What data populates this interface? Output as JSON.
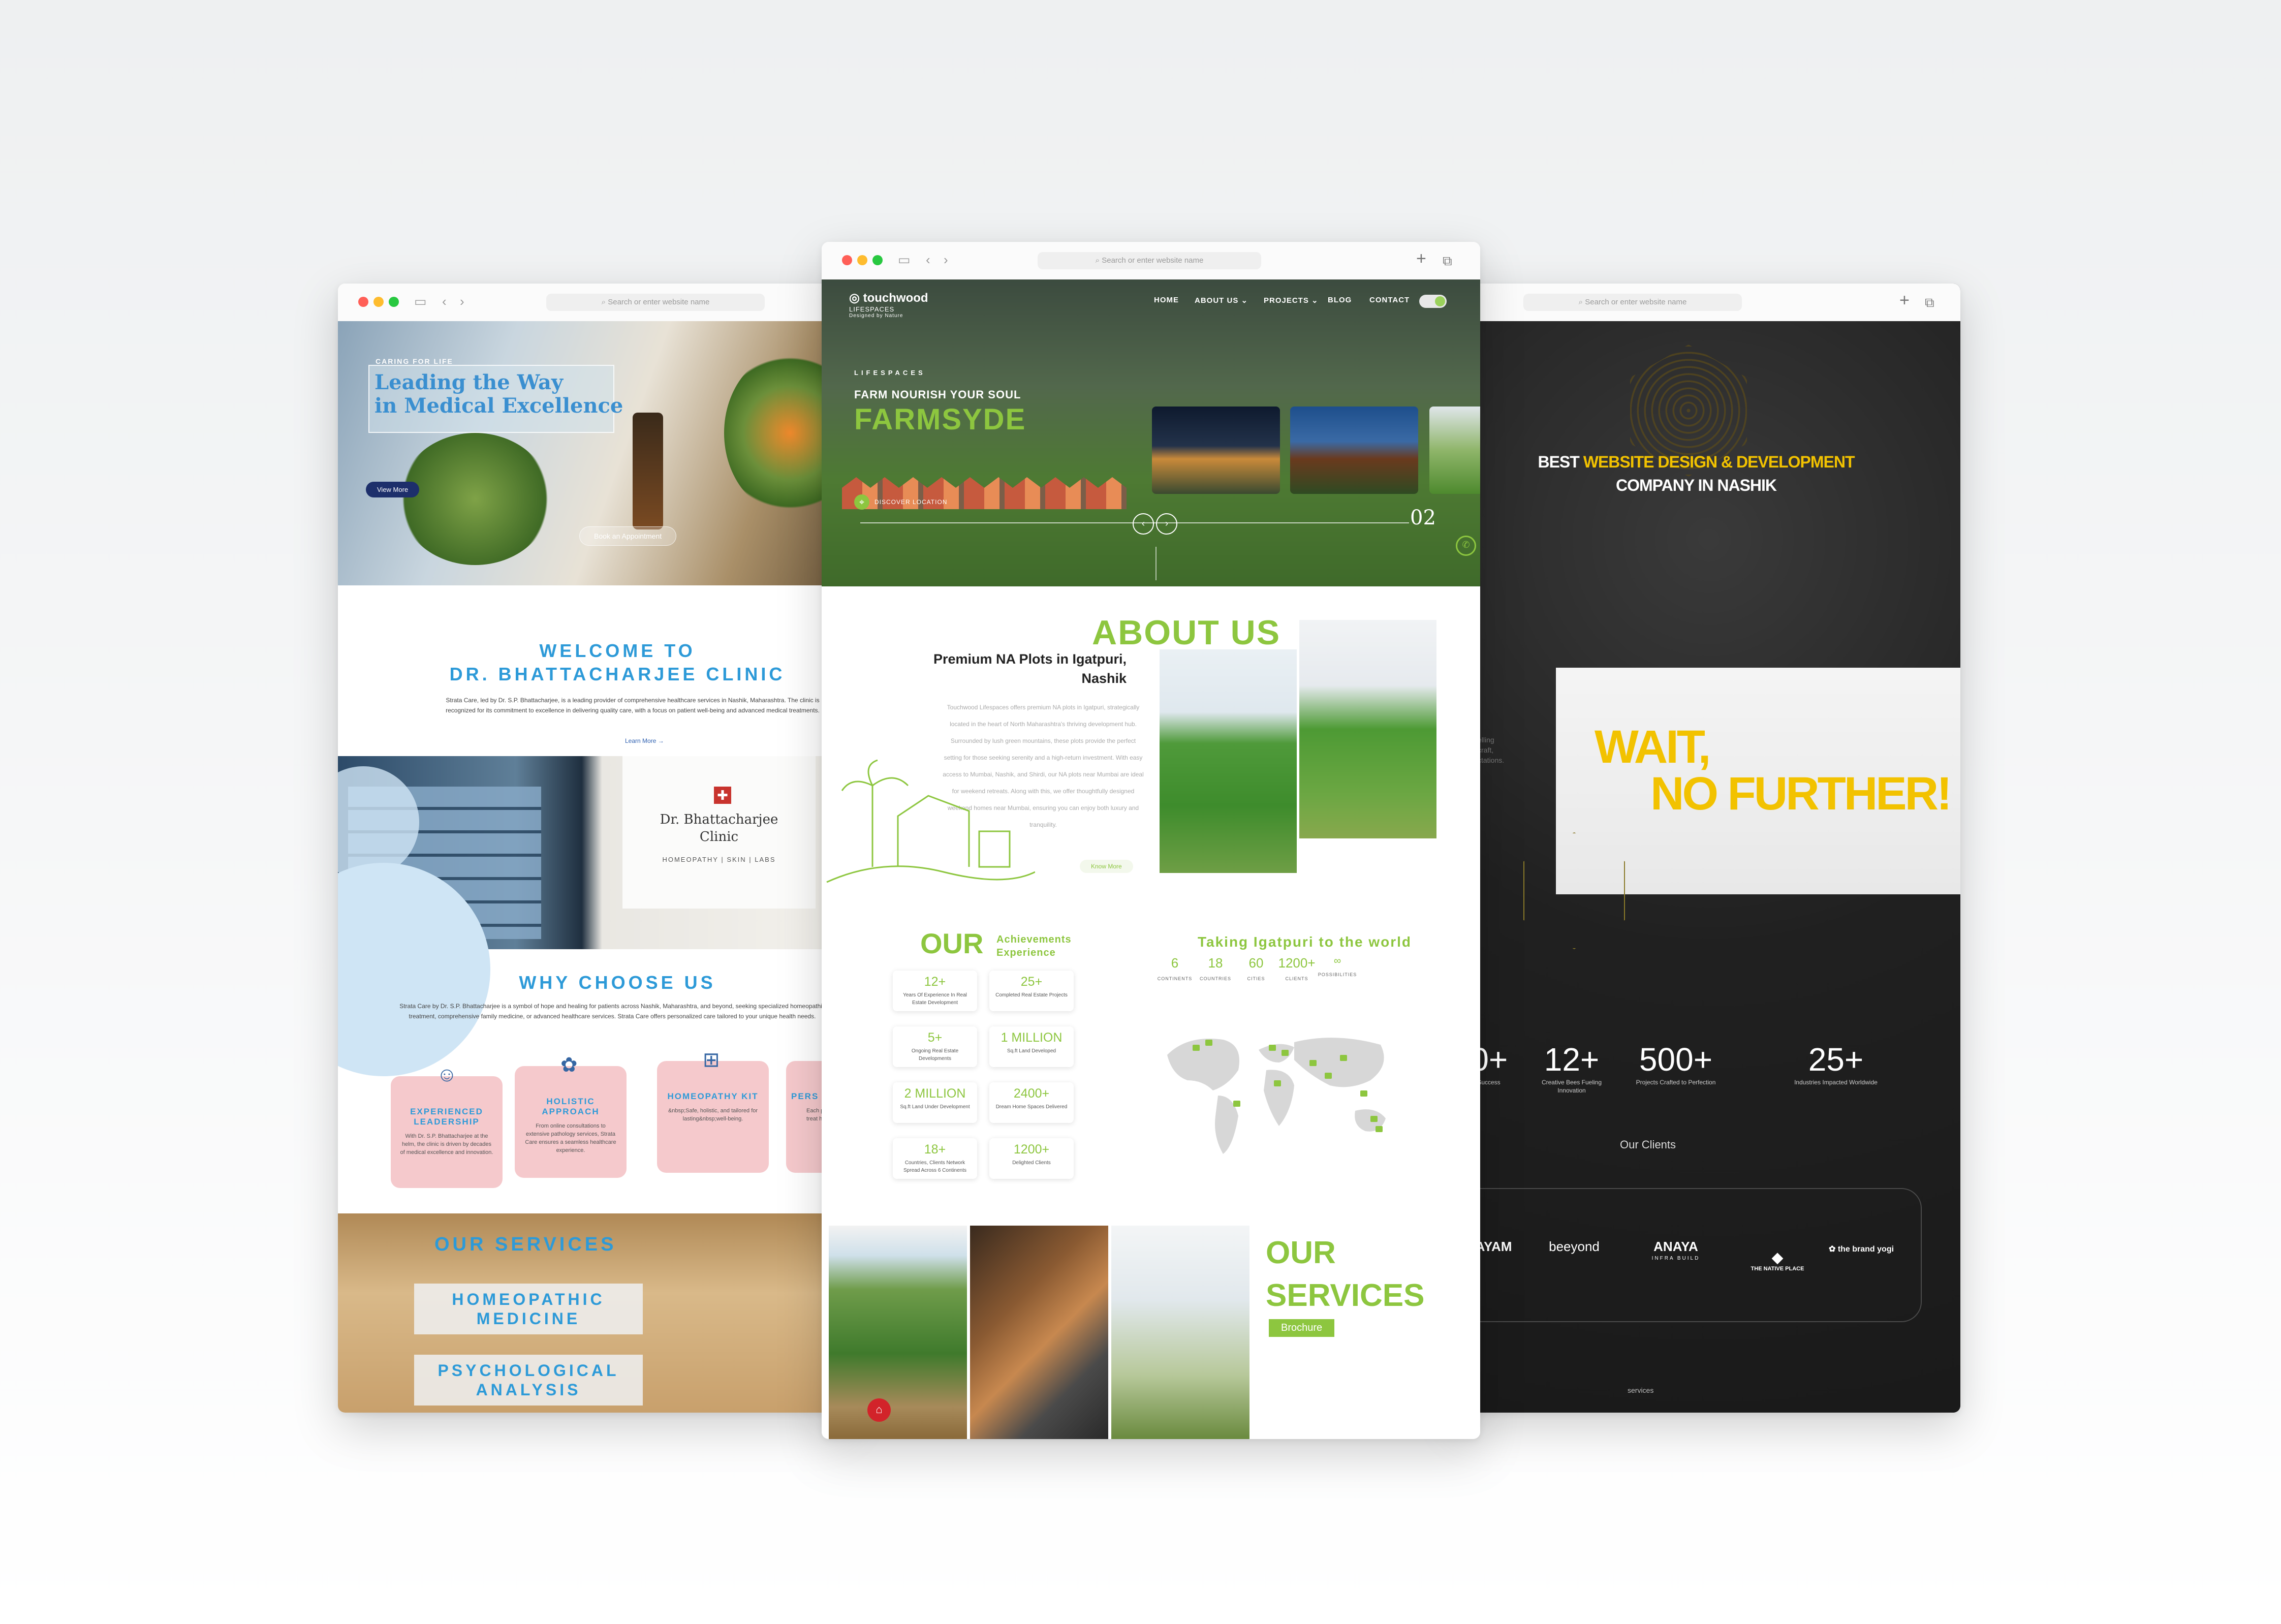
{
  "browser": {
    "url_placeholder": "Search or enter website name",
    "plus_icon": "+",
    "tabs_icon": "⧉"
  },
  "left_site": {
    "hero": {
      "kicker": "CARING FOR LIFE",
      "title_line1": "Leading the Way",
      "title_line2": "in Medical Excellence",
      "view_more": "View More",
      "book": "Book an Appointment"
    },
    "welcome": {
      "line1": "WELCOME TO",
      "line2": "DR. BHATTACHARJEE CLINIC",
      "paragraph": "Strata Care, led by Dr. S.P. Bhattacharjee, is a leading provider of comprehensive healthcare services in Nashik, Maharashtra. The clinic is recognized for its commitment to excellence in delivering quality care, with a focus on patient well-being and advanced medical treatments.",
      "learn_more": "Learn More →"
    },
    "clinic_sign": {
      "name_line1": "Dr. Bhattacharjee",
      "name_line2": "Clinic",
      "tagline": "HOMEOPATHY | SKIN | LABS"
    },
    "why": {
      "title": "WHY CHOOSE US",
      "paragraph": "Strata Care by Dr. S.P. Bhattacharjee is a symbol of hope and healing for patients across Nashik, Maharashtra, and beyond, seeking specialized homeopathic treatment, comprehensive family medicine, or advanced healthcare services. Strata Care offers personalized care tailored to your unique health needs.",
      "cards": [
        {
          "title": "EXPERIENCED LEADERSHIP",
          "desc": "With Dr. S.P. Bhattacharjee at the helm, the clinic is driven by decades of medical excellence and innovation."
        },
        {
          "title": "HOLISTIC APPROACH",
          "desc": "From online consultations to extensive pathology services, Strata Care ensures a seamless healthcare experience."
        },
        {
          "title": "HOMEOPATHY KIT",
          "desc": "&nbsp;Safe, holistic, and tailored for lasting&nbsp;well-being."
        },
        {
          "title": "PERS",
          "desc": "Each perso treat he"
        }
      ]
    },
    "services": {
      "title": "OUR SERVICES",
      "items": [
        {
          "line1": "HOMEOPATHIC",
          "line2": "MEDICINE"
        },
        {
          "line1": "PSYCHOLOGICAL",
          "line2": "ANALYSIS"
        }
      ]
    }
  },
  "center_site": {
    "logo": {
      "name": "touchwood",
      "sub": "LIFESPACES",
      "tag": "Designed by Nature"
    },
    "nav": [
      "HOME",
      "ABOUT US ⌄",
      "PROJECTS ⌄",
      "BLOG",
      "CONTACT"
    ],
    "hero": {
      "kicker": "LIFESPACES",
      "subtitle": "FARM NOURISH YOUR SOUL",
      "title": "FARMSYDE",
      "location": "DISCOVER LOCATION",
      "slide_number": "02",
      "prev": "‹",
      "next": "›"
    },
    "about": {
      "title": "ABOUT US",
      "subtitle_line1": "Premium NA Plots in Igatpuri,",
      "subtitle_line2": "Nashik",
      "paragraph": "Touchwood Lifespaces offers premium NA plots in Igatpuri, strategically located in the heart of North Maharashtra's thriving development hub. Surrounded by lush green mountains, these plots provide the perfect setting for those seeking serenity and a high-return investment. With easy access to Mumbai, Nashik, and Shirdi, our NA plots near Mumbai are ideal for weekend retreats. Along with this, we offer thoughtfully designed weekend homes near Mumbai, ensuring you can enjoy both luxury and tranquility.",
      "know_more": "Know More"
    },
    "achievements": {
      "our": "OUR",
      "label_line1": "Achievements",
      "label_line2": "Experience",
      "stats": [
        {
          "value": "12+",
          "label": "Years Of Experience In Real Estate Development"
        },
        {
          "value": "25+",
          "label": "Completed Real Estate Projects"
        },
        {
          "value": "5+",
          "label": "Ongoing Real Estate Developments"
        },
        {
          "value": "1 MILLION",
          "label": "Sq.ft Land Developed"
        },
        {
          "value": "2 MILLION",
          "label": "Sq.ft Land Under Development"
        },
        {
          "value": "2400+",
          "label": "Dream Home Spaces Delivered"
        },
        {
          "value": "18+",
          "label": "Countries, Clients Network Spread Across 6 Continents"
        },
        {
          "value": "1200+",
          "label": "Delighted Clients"
        }
      ]
    },
    "world": {
      "title": "Taking Igatpuri to the world",
      "stats": [
        {
          "value": "6",
          "label": "CONTINENTS"
        },
        {
          "value": "18",
          "label": "COUNTRIES"
        },
        {
          "value": "60",
          "label": "CITIES"
        },
        {
          "value": "1200+",
          "label": "CLIENTS"
        },
        {
          "value": "∞",
          "label": "POSSIBILITIES"
        }
      ]
    },
    "services": {
      "line1": "OUR",
      "line2": "SERVICES",
      "brochure": "Brochure"
    }
  },
  "right_site": {
    "headline_pre": "BEST ",
    "headline_hl": "WEBSITE DESIGN & DEVELOPMENT",
    "headline_post": "COMPANY IN NASHIK",
    "wait_line1": "WAIT,",
    "wait_line2": "NO FURTHER!",
    "fragment_line1": "elling",
    "fragment_line2": "craft,",
    "fragment_line3": "ctations.",
    "stats": [
      {
        "value": "00+",
        "label": "s with Success"
      },
      {
        "value": "12+",
        "label": "Creative Bees Fueling Innovation"
      },
      {
        "value": "500+",
        "label": "Projects Crafted to Perfection"
      },
      {
        "value": "25+",
        "label": "Industries Impacted Worldwide"
      }
    ],
    "clients_title": "Our Clients",
    "clients": [
      {
        "name": "WAYAM",
        "sub": ""
      },
      {
        "name": "beeyond",
        "sub": ""
      },
      {
        "name": "ANAYA",
        "sub": "INFRA BUILD"
      },
      {
        "name": "THE NATIVE PLACE",
        "sub": ""
      },
      {
        "name": "the brand yogi",
        "sub": ""
      }
    ],
    "footer": "services"
  },
  "colors": {
    "green": "#8dc63f",
    "blue": "#2d9ad8",
    "yellow": "#f2c200",
    "pink": "#f5c9cc"
  }
}
